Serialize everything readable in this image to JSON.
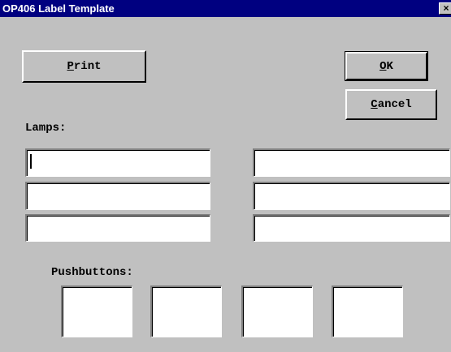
{
  "window": {
    "title": "OP406 Label Template",
    "close_glyph": "×"
  },
  "buttons": {
    "print": {
      "mnemonic": "P",
      "rest": "rint"
    },
    "ok": {
      "mnemonic": "O",
      "rest": "K"
    },
    "cancel": {
      "mnemonic": "C",
      "rest": "ancel"
    }
  },
  "lamps": {
    "label": "Lamps:",
    "fields": [
      {
        "value": ""
      },
      {
        "value": ""
      },
      {
        "value": ""
      },
      {
        "value": ""
      },
      {
        "value": ""
      },
      {
        "value": ""
      }
    ]
  },
  "pushbuttons": {
    "label": "Pushbuttons:",
    "count": 4
  },
  "colors": {
    "title_bar": "#000080",
    "face": "#c0c0c0",
    "field": "#ffffff"
  }
}
